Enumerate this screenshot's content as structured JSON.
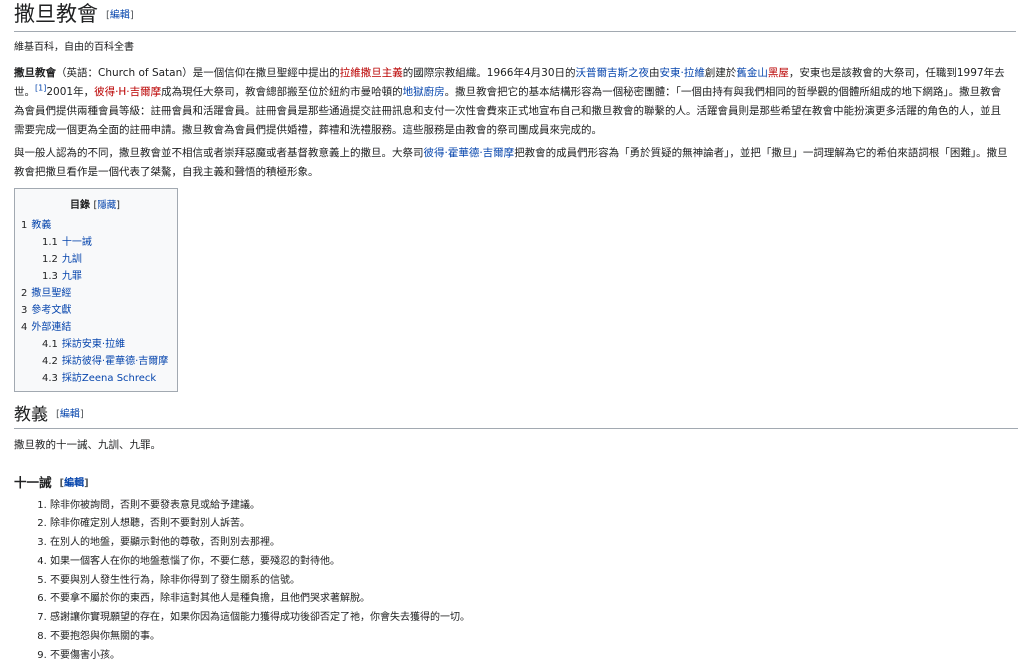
{
  "title": "撒旦教會",
  "edit_label": "編輯",
  "site_sub": "維基百科，自由的百科全書",
  "lead": {
    "bold_name": "撒旦教會",
    "t1": "（英語：Church of Satan）是一個信仰在撒旦聖經中提出的",
    "l1": "拉維撒旦主義",
    "t2": "的國際宗教組織。1966年4月30日的",
    "l2": "沃普爾吉斯之夜",
    "t3": "由",
    "l3": "安東·拉維",
    "t4": "創建於",
    "l4": "舊金山",
    "l5": "黑屋",
    "t5": "，安東也是該教會的大祭司，任職到1997年去世。",
    "ref": "[1]",
    "t6": "2001年，",
    "l6": "彼得·H·吉爾摩",
    "t7": "成為現任大祭司，教會總部搬至位於紐約市曼哈頓的",
    "l7": "地獄廚房",
    "t8": "。撒旦教會把它的基本結構形容為一個秘密團體：「一個由持有與我們相同的哲學觀的個體所組成的地下網路」。撒旦教會為會員們提供兩種會員等級：註冊會員和活躍會員。註冊會員是那些通過提交註冊訊息和支付一次性會費來正式地宣布自己和撒旦教會的聯繫的人。活躍會員則是那些希望在教會中能扮演更多活躍的角色的人，並且需要完成一個更為全面的註冊申請。撒旦教會為會員們提供婚禮，葬禮和洗禮服務。這些服務是由教會的祭司團成員來完成的。"
  },
  "para2": {
    "t1": "與一般人認為的不同，撒旦教會並不相信或者崇拜惡魔或者基督教意義上的撒旦。大祭司",
    "l1": "彼得·霍華德·吉爾摩",
    "t2": "把教會的成員們形容為「勇於質疑的無神論者」，並把「撒旦」一詞理解為它的希伯來語詞根「困難」。撒旦教會把撒旦看作是一個代表了桀驁，自我主義和聲悟的積極形象。"
  },
  "toc": {
    "title": "目錄",
    "toggle": "隱藏",
    "items": [
      {
        "num": "1",
        "text": "教義",
        "level": 1
      },
      {
        "num": "1.1",
        "text": "十一誡",
        "level": 2
      },
      {
        "num": "1.2",
        "text": "九訓",
        "level": 2
      },
      {
        "num": "1.3",
        "text": "九罪",
        "level": 2
      },
      {
        "num": "2",
        "text": "撒旦聖經",
        "level": 1
      },
      {
        "num": "3",
        "text": "參考文獻",
        "level": 1
      },
      {
        "num": "4",
        "text": "外部連結",
        "level": 1
      },
      {
        "num": "4.1",
        "text": "採訪安東·拉維",
        "level": 2
      },
      {
        "num": "4.2",
        "text": "採訪彼得·霍華德·吉爾摩",
        "level": 2
      },
      {
        "num": "4.3",
        "text": "採訪Zeena Schreck",
        "level": 2
      }
    ]
  },
  "doctrine": {
    "heading": "教義",
    "intro": "撒旦教的十一誡、九訓、九罪。"
  },
  "commandments": {
    "heading": "十一誡",
    "items": [
      "除非你被詢問，否則不要發表意見或給予建議。",
      "除非你確定別人想聽，否則不要對別人訴苦。",
      "在別人的地盤，要顯示對他的尊敬，否則別去那裡。",
      "如果一個客人在你的地盤惹惱了你，不要仁慈，要殘忍的對待他。",
      "不要與別人發生性行為，除非你得到了發生關系的信號。",
      "不要拿不屬於你的東西，除非這對其他人是種負擔，且他們哭求著解脫。",
      "感謝讓你實現願望的存在，如果你因為這個能力獲得成功後卻否定了祂，你會失去獲得的一切。",
      "不要抱怨與你無關的事。",
      "不要傷害小孩。"
    ]
  }
}
